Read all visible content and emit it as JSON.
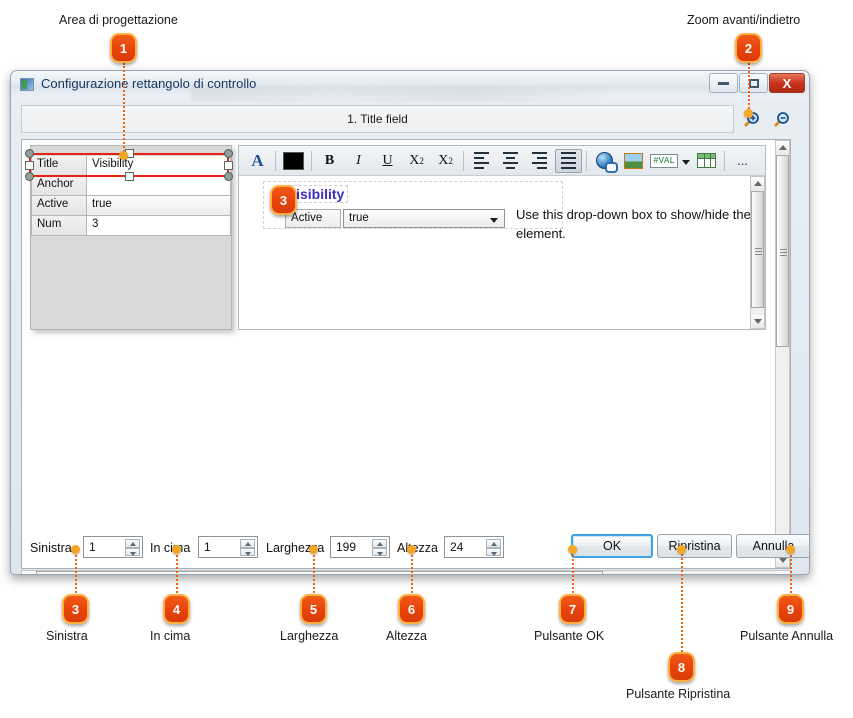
{
  "annotations": {
    "top": [
      {
        "num": "1",
        "label": "Area di progettazione"
      },
      {
        "num": "2",
        "label": "Zoom avanti/indietro"
      }
    ],
    "bottom": [
      {
        "num": "3",
        "label": "Sinistra"
      },
      {
        "num": "4",
        "label": "In cima"
      },
      {
        "num": "5",
        "label": "Larghezza"
      },
      {
        "num": "6",
        "label": "Altezza"
      },
      {
        "num": "7",
        "label": "Pulsante OK"
      },
      {
        "num": "8",
        "label": "Pulsante Ripristina"
      },
      {
        "num": "9",
        "label": "Pulsante Annulla"
      }
    ],
    "inline": [
      {
        "num": "3"
      }
    ]
  },
  "dialog": {
    "title": "Configurazione rettangolo di controllo",
    "window_buttons": {
      "minimize": "minimize-icon",
      "maximize": "maximize-icon",
      "close": "X"
    },
    "tab": {
      "label": "1. Title field"
    },
    "zoom_controls": {
      "zoom_in": "zoom-in-icon",
      "zoom_out": "zoom-out-icon"
    },
    "property_grid": {
      "rows": [
        {
          "key": "Title",
          "value": "Visibility",
          "type": "text"
        },
        {
          "key": "Anchor",
          "value": "",
          "type": "text"
        },
        {
          "key": "Active",
          "value": "true",
          "type": "combo"
        },
        {
          "key": "Num",
          "value": "3",
          "type": "spinner"
        }
      ]
    },
    "rich_text_toolbar": {
      "buttons": [
        {
          "name": "font-icon",
          "glyph": "A"
        },
        {
          "name": "text-color-swatch",
          "color": "#000000"
        },
        {
          "name": "bold-icon",
          "glyph": "B"
        },
        {
          "name": "italic-icon",
          "glyph": "I"
        },
        {
          "name": "underline-icon",
          "glyph": "U"
        },
        {
          "name": "subscript-icon",
          "glyph": "X"
        },
        {
          "name": "superscript-icon",
          "glyph": "X"
        },
        {
          "name": "align-left-icon",
          "glyph": ""
        },
        {
          "name": "align-center-icon",
          "glyph": ""
        },
        {
          "name": "align-right-icon",
          "glyph": ""
        },
        {
          "name": "align-justify-icon",
          "glyph": "",
          "pressed": true
        },
        {
          "name": "hyperlink-icon",
          "glyph": ""
        },
        {
          "name": "image-icon",
          "glyph": ""
        },
        {
          "name": "value-field-icon",
          "glyph": "#VAL"
        },
        {
          "name": "table-icon",
          "glyph": ""
        },
        {
          "name": "more-options-icon",
          "glyph": "..."
        }
      ]
    },
    "content": {
      "heading": "Visibility",
      "field_label": "Active",
      "field_value": "true",
      "hint": "Use this drop-down box to show/hide the element."
    },
    "bottom_fields": [
      {
        "label": "Sinistra",
        "value": "1"
      },
      {
        "label": "In cima",
        "value": "1"
      },
      {
        "label": "Larghezza",
        "value": "199"
      },
      {
        "label": "Altezza",
        "value": "24"
      }
    ],
    "buttons": [
      {
        "label": "OK",
        "default": true
      },
      {
        "label": "Ripristina",
        "default": false
      },
      {
        "label": "Annulla",
        "default": false
      }
    ]
  },
  "colors": {
    "badge_fill": "#e8430c",
    "badge_border": "#fbb040",
    "leader": "#f2650f",
    "selection": "#e42313",
    "heading": "#3a2fc0",
    "default_button_border": "#3fa3e0"
  }
}
